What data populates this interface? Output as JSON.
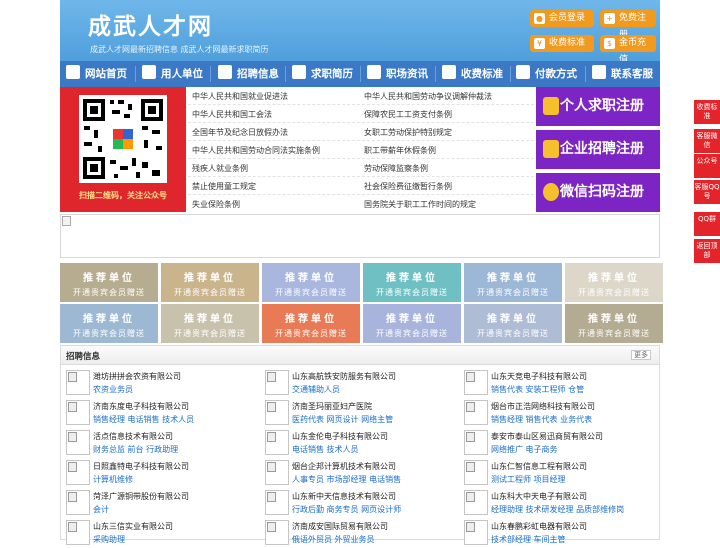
{
  "header": {
    "logo": "成武人才网",
    "slogan": "成武人才网最新招聘信息   成武人才网最新求职简历",
    "buttons": [
      {
        "label": "会员登录",
        "icon": "user-icon"
      },
      {
        "label": "免费注册",
        "icon": "register-icon"
      },
      {
        "label": "收费标准",
        "icon": "price-icon"
      },
      {
        "label": "金币充值",
        "icon": "coin-icon"
      }
    ]
  },
  "nav": [
    {
      "label": "网站首页",
      "icon": "home-icon"
    },
    {
      "label": "用人单位",
      "icon": "building-icon"
    },
    {
      "label": "招聘信息",
      "icon": "recruit-icon"
    },
    {
      "label": "求职简历",
      "icon": "resume-icon"
    },
    {
      "label": "职场资讯",
      "icon": "news-icon"
    },
    {
      "label": "收费标准",
      "icon": "price-icon"
    },
    {
      "label": "付款方式",
      "icon": "payment-icon"
    },
    {
      "label": "联系客服",
      "icon": "phone-icon"
    }
  ],
  "qr_caption": "扫描二维码，关注公众号",
  "law_links": [
    "中华人民共和国就业促进法",
    "中华人民共和国劳动争议调解仲裁法",
    "中华人民共和国工会法",
    "保障农民工工资支付条例",
    "全国年节及纪念日放假办法",
    "女职工劳动保护特别规定",
    "中华人民共和国劳动合同法实施条例",
    "职工带薪年休假条例",
    "残疾人就业条例",
    "劳动保障监察条例",
    "禁止使用童工规定",
    "社会保险费征缴暂行条例",
    "失业保险条例",
    "国务院关于职工工作时间的规定"
  ],
  "register_buttons": [
    "个人求职注册",
    "企业招聘注册",
    "微信扫码注册"
  ],
  "recommend": {
    "title": "推荐单位",
    "subtitle": "开通贵宾会员赠送",
    "colors": [
      "#b6ad90",
      "#c9b48c",
      "#a9b6de",
      "#6ec0c3",
      "#9db7d7",
      "#dcd7c8",
      "#9db8d3",
      "#c8c2ad",
      "#e87a55",
      "#a9b4dd",
      "#aebcd6",
      "#b3ab92"
    ]
  },
  "jobs_section": {
    "title": "招聘信息",
    "more": "更多",
    "items": [
      {
        "company": "潍坊拼拼会农资有限公司",
        "positions": "农资业务员"
      },
      {
        "company": "山东高航铁安防服务有限公司",
        "positions": "交通辅助人员"
      },
      {
        "company": "山东天竞电子科技有限公司",
        "positions": "销售代表 安装工程师 仓管"
      },
      {
        "company": "济南东度电子科技有限公司",
        "positions": "销售经理 电话销售 技术人员"
      },
      {
        "company": "济南圣玛丽亚妇产医院",
        "positions": "医药代表 网页设计 网络主管"
      },
      {
        "company": "烟台市正浩网络科技有限公司",
        "positions": "销售经理 销售代表 业务代表"
      },
      {
        "company": "活点信息技术有限公司",
        "positions": "财务总监 前台 行政助理"
      },
      {
        "company": "山东金伦电子科技有限公司",
        "positions": "电话销售 技术人员"
      },
      {
        "company": "泰安市泰山区易迅商贸有限公司",
        "positions": "网络推广 电子商务"
      },
      {
        "company": "日照鑫特电子科技有限公司",
        "positions": "计算机维修"
      },
      {
        "company": "烟台企邦计算机技术有限公司",
        "positions": "人事专员 市场部经理 电话销售"
      },
      {
        "company": "山东仁智信息工程有限公司",
        "positions": "测试工程师 项目经理"
      },
      {
        "company": "菏泽广源铜带股份有限公司",
        "positions": "会计"
      },
      {
        "company": "山东新中天信息技术有限公司",
        "positions": "行政后勤 商务专员 网页设计师"
      },
      {
        "company": "山东科大中天电子有限公司",
        "positions": "经理助理 技术研发经理 品质部维修岗"
      },
      {
        "company": "山东三信实业有限公司",
        "positions": "采购助理"
      },
      {
        "company": "济南成安国际贸易有限公司",
        "positions": "俄语外贸员 外贸业务员"
      },
      {
        "company": "山东春鹏彩虹电器有限公司",
        "positions": "技术部经理 车间主管"
      }
    ]
  },
  "side_bar": [
    "收费标准",
    "客服微信",
    "公众号",
    "客服QQ号",
    "QQ群",
    "返回顶部"
  ]
}
